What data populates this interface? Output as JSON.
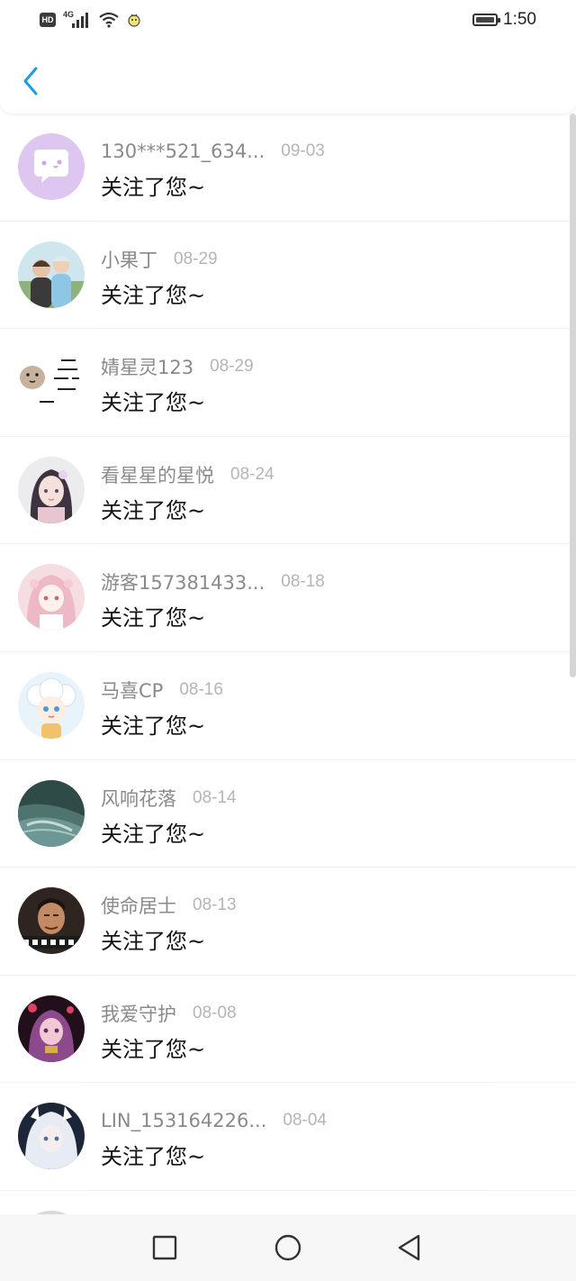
{
  "status_bar": {
    "hd_label": "HD",
    "network_type": "4G",
    "time": "1:50"
  },
  "colors": {
    "accent": "#1e9be8",
    "name_text": "#8a8a8a",
    "date_text": "#b5b5b5",
    "message_text": "#141414"
  },
  "icons": {
    "back": "chevron-left-icon",
    "recent_apps": "square-icon",
    "home": "circle-icon",
    "back_nav": "triangle-left-icon"
  },
  "notifications": [
    {
      "name": "130***521_634...",
      "date": "09-03",
      "message": "关注了您~"
    },
    {
      "name": "小果丁",
      "date": "08-29",
      "message": "关注了您~"
    },
    {
      "name": "婧星灵123",
      "date": "08-29",
      "message": "关注了您~"
    },
    {
      "name": "看星星的星悦",
      "date": "08-24",
      "message": "关注了您~"
    },
    {
      "name": "游客157381433...",
      "date": "08-18",
      "message": "关注了您~"
    },
    {
      "name": "马喜CP",
      "date": "08-16",
      "message": "关注了您~"
    },
    {
      "name": "风响花落",
      "date": "08-14",
      "message": "关注了您~"
    },
    {
      "name": "使命居士",
      "date": "08-13",
      "message": "关注了您~"
    },
    {
      "name": "我爱守护",
      "date": "08-08",
      "message": "关注了您~"
    },
    {
      "name": "LIN_153164226...",
      "date": "08-04",
      "message": "关注了您~"
    }
  ]
}
